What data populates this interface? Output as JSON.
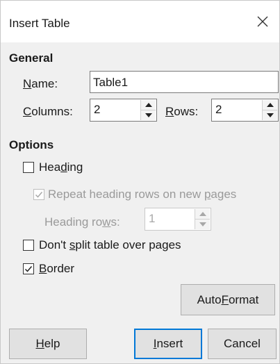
{
  "dialog": {
    "title": "Insert Table"
  },
  "general": {
    "heading": "General",
    "name_label_pre": "",
    "name_label_accel": "N",
    "name_label_post": "ame:",
    "name_value": "Table1",
    "columns_label_accel": "C",
    "columns_label_post": "olumns:",
    "columns_value": "2",
    "rows_label_accel": "R",
    "rows_label_post": "ows:",
    "rows_value": "2"
  },
  "options": {
    "heading": "Options",
    "heading_cb_pre": "Hea",
    "heading_cb_accel": "d",
    "heading_cb_post": "ing",
    "heading_checked": false,
    "repeat_pre": "Repeat heading rows on new ",
    "repeat_accel": "p",
    "repeat_post": "ages",
    "repeat_checked": true,
    "heading_rows_pre": "Heading ro",
    "heading_rows_accel": "w",
    "heading_rows_post": "s:",
    "heading_rows_value": "1",
    "dont_split_pre": "Don't ",
    "dont_split_accel": "s",
    "dont_split_post": "plit table over pages",
    "dont_split_checked": false,
    "border_pre": "",
    "border_accel": "B",
    "border_post": "order",
    "border_checked": true
  },
  "buttons": {
    "autoformat_pre": "Auto",
    "autoformat_accel": "F",
    "autoformat_post": "ormat",
    "help_accel": "H",
    "help_post": "elp",
    "insert_accel": "I",
    "insert_post": "nsert",
    "cancel": "Cancel"
  },
  "icons": {
    "close": "close-icon",
    "spin_up": "spin-up-icon",
    "spin_down": "spin-down-icon",
    "checkmark": "checkmark-icon"
  },
  "colors": {
    "default_button_border": "#0078d7",
    "dialog_background": "#f0f0f0"
  }
}
